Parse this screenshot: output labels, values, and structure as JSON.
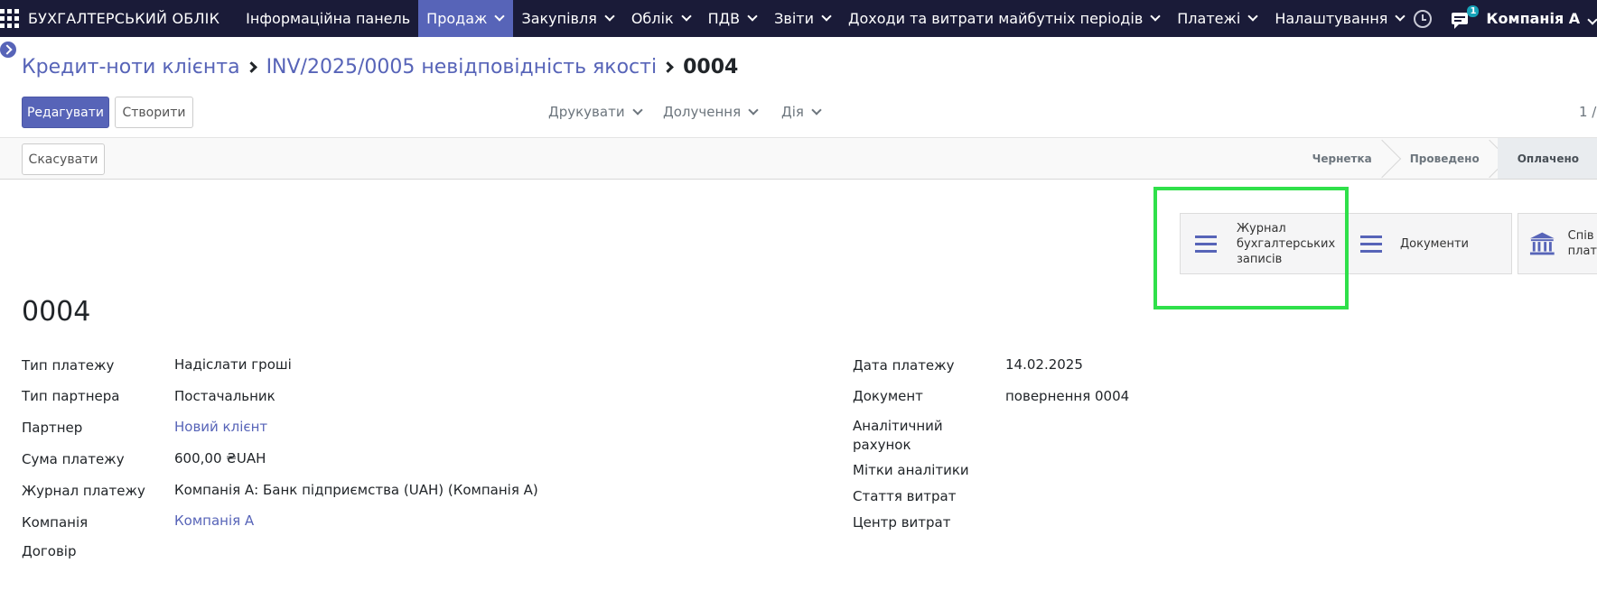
{
  "navbar": {
    "brand": "БУХГАЛТЕРСЬКИЙ ОБЛІК",
    "menu": [
      {
        "label": "Інформаційна панель",
        "dropdown": false,
        "active": false
      },
      {
        "label": "Продаж",
        "dropdown": true,
        "active": true
      },
      {
        "label": "Закупівля",
        "dropdown": true,
        "active": false
      },
      {
        "label": "Облік",
        "dropdown": true,
        "active": false
      },
      {
        "label": "ПДВ",
        "dropdown": true,
        "active": false
      },
      {
        "label": "Звіти",
        "dropdown": true,
        "active": false
      },
      {
        "label": "Доходи та витрати майбутніх періодів",
        "dropdown": true,
        "active": false
      },
      {
        "label": "Платежі",
        "dropdown": true,
        "active": false
      },
      {
        "label": "Налаштування",
        "dropdown": true,
        "active": false
      }
    ],
    "messages_count": "1",
    "company": "Компанія А"
  },
  "breadcrumb": {
    "root": "Кредит-ноти клієнта",
    "parent": "INV/2025/0005 невідповідність якості",
    "current": "0004"
  },
  "toolbar": {
    "edit_label": "Редагувати",
    "create_label": "Створити",
    "print_label": "Друкувати",
    "attachments_label": "Долучення",
    "action_label": "Дія",
    "pager": "1 /"
  },
  "statusbar": {
    "cancel_label": "Скасувати",
    "stages": [
      {
        "label": "Чернетка",
        "current": false
      },
      {
        "label": "Проведено",
        "current": false
      },
      {
        "label": "Оплачено",
        "current": true
      }
    ]
  },
  "smart_buttons": {
    "journal_lines": [
      "Журнал",
      "бухгалтерських",
      "записів"
    ],
    "documents": "Документи",
    "reconcile_lines": [
      "Спів",
      "плат"
    ]
  },
  "form": {
    "title": "0004",
    "left": [
      {
        "label": "Тип платежу",
        "value": "Надіслати гроші",
        "link": false
      },
      {
        "label": "Тип партнера",
        "value": "Постачальник",
        "link": false
      },
      {
        "label": "Партнер",
        "value": "Новий клієнт",
        "link": true
      },
      {
        "label": "Сума платежу",
        "value": "600,00 ₴UAH",
        "link": false
      },
      {
        "label": "Журнал платежу",
        "value": "Компанія А: Банк підприємства (UAH) (Компанія А)",
        "link": false
      },
      {
        "label": "Компанія",
        "value": "Компанія А",
        "link": true
      },
      {
        "label": "Договір",
        "value": "",
        "link": false
      }
    ],
    "right": [
      {
        "label": "Дата платежу",
        "value": "14.02.2025"
      },
      {
        "label": "Документ",
        "value": "повернення 0004"
      },
      {
        "label_lines": [
          "Аналітичний",
          "рахунок"
        ],
        "value": ""
      },
      {
        "label": "Мітки аналітики",
        "value": ""
      },
      {
        "label": "Стаття витрат",
        "value": ""
      },
      {
        "label": "Центр витрат",
        "value": ""
      }
    ]
  },
  "colors": {
    "navbar_bg": "#1a1b38",
    "accent": "#5764b8",
    "highlight": "#2fe04a"
  }
}
